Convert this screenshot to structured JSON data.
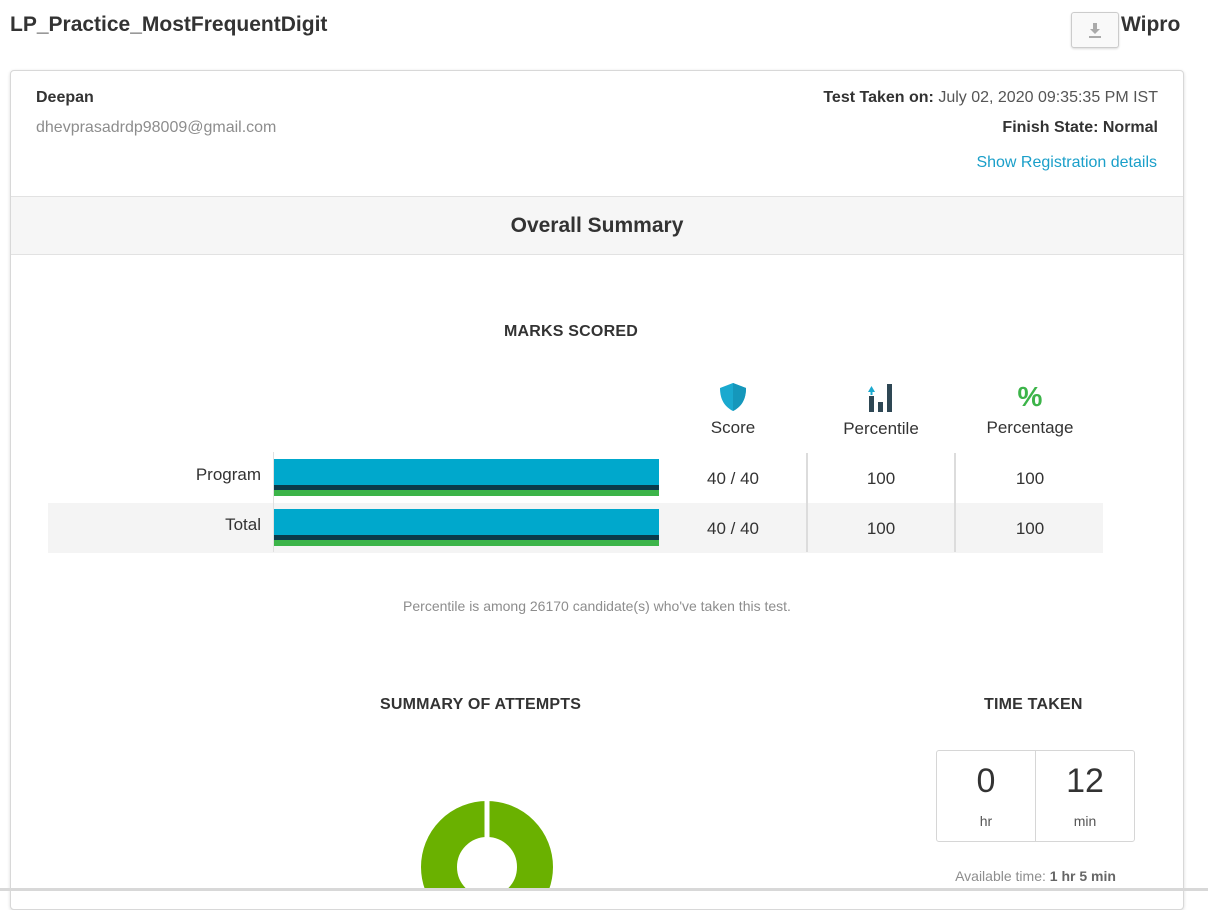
{
  "header": {
    "title": "LP_Practice_MostFrequentDigit",
    "org": "Wipro",
    "download_icon": "download-icon"
  },
  "candidate": {
    "name": "Deepan",
    "email": "dhevprasadrdp98009@gmail.com",
    "taken_label": "Test Taken on:",
    "taken_value": "July 02, 2020 09:35:35 PM IST",
    "finish_state": "Finish State: Normal",
    "registration_link": "Show Registration details"
  },
  "summary": {
    "title": "Overall Summary"
  },
  "marks": {
    "heading": "MARKS SCORED",
    "columns": [
      {
        "label": "Score",
        "icon": "shield-icon"
      },
      {
        "label": "Percentile",
        "icon": "bar-chart-icon"
      },
      {
        "label": "Percentage",
        "icon": "percent-icon"
      }
    ],
    "rows": [
      {
        "label": "Program",
        "score": "40 / 40",
        "percentile": "100",
        "percentage": "100",
        "fill": 1.0
      },
      {
        "label": "Total",
        "score": "40 / 40",
        "percentile": "100",
        "percentage": "100",
        "fill": 1.0
      }
    ],
    "note": "Percentile is among 26170 candidate(s) who've taken this test."
  },
  "attempts": {
    "heading": "SUMMARY OF ATTEMPTS",
    "donut_color": "#6ab100"
  },
  "time": {
    "heading": "TIME TAKEN",
    "hours": "0",
    "hours_unit": "hr",
    "minutes": "12",
    "minutes_unit": "min",
    "available_label": "Available time:",
    "available_value": "1 hr 5 min"
  },
  "colors": {
    "accent": "#00a8cc",
    "dark": "#0b3a4a",
    "green": "#3cb449",
    "link": "#1a9fc9"
  }
}
